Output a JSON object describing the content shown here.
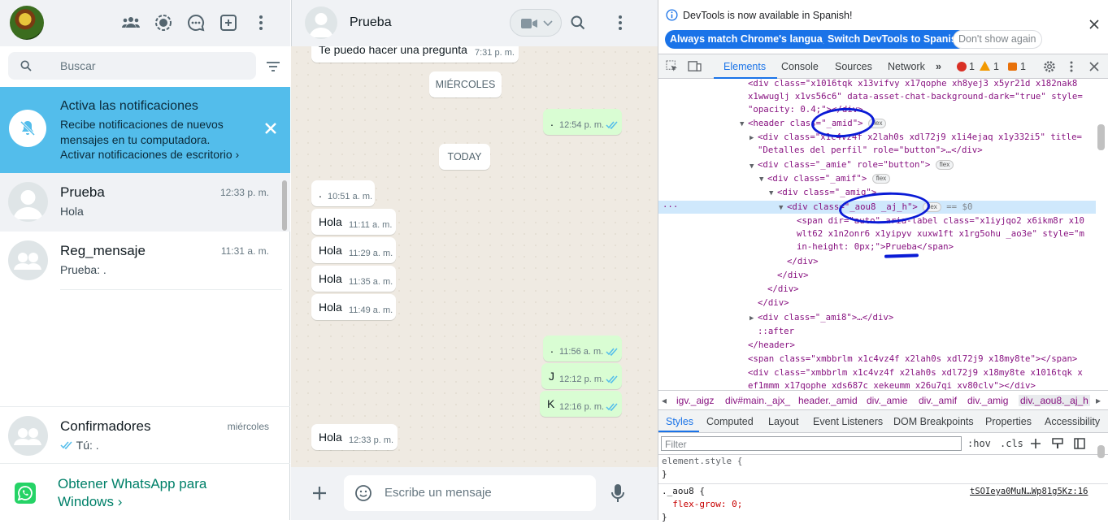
{
  "left": {
    "search_placeholder": "Buscar",
    "notification": {
      "title": "Activa las notificaciones",
      "body": "Recibe notificaciones de nuevos mensajes en tu computadora.",
      "link": "Activar notificaciones de escritorio"
    },
    "chats": [
      {
        "name": "Prueba",
        "time": "12:33 p. m.",
        "preview": "Hola"
      },
      {
        "name": "Reg_mensaje",
        "time": "11:31 a. m.",
        "preview": "Prueba: ."
      },
      {
        "name": "Confirmadores",
        "time": "miércoles",
        "preview": "Tú: ."
      }
    ],
    "get_app": "Obtener WhatsApp para Windows"
  },
  "center": {
    "contact_name": "Prueba",
    "input_placeholder": "Escribe un mensaje",
    "messages": [
      {
        "dir": "in",
        "text": "Te puedo hacer una pregunta",
        "time": "7:31 p. m."
      },
      {
        "dir": "date",
        "text": "MIÉRCOLES"
      },
      {
        "dir": "out",
        "text": ".",
        "time": "12:54 p. m."
      },
      {
        "dir": "date",
        "text": "TODAY"
      },
      {
        "dir": "in",
        "text": ".",
        "time": "10:51 a. m."
      },
      {
        "dir": "in",
        "text": "Hola",
        "time": "11:11 a. m."
      },
      {
        "dir": "in",
        "text": "Hola",
        "time": "11:29 a. m."
      },
      {
        "dir": "in",
        "text": "Hola",
        "time": "11:35 a. m."
      },
      {
        "dir": "in",
        "text": "Hola",
        "time": "11:49 a. m."
      },
      {
        "dir": "out",
        "text": ".",
        "time": "11:56 a. m."
      },
      {
        "dir": "out",
        "text": "J",
        "time": "12:12 p. m."
      },
      {
        "dir": "out",
        "text": "K",
        "time": "12:16 p. m."
      },
      {
        "dir": "in",
        "text": "Hola",
        "time": "12:33 p. m."
      }
    ]
  },
  "devtools": {
    "info_message": "DevTools is now available in Spanish!",
    "btn_match": "Always match Chrome's language",
    "btn_switch": "Switch DevTools to Spanish",
    "btn_dont_show": "Don't show again",
    "tabs": [
      "Elements",
      "Console",
      "Sources",
      "Network"
    ],
    "error_count": "1",
    "warning_count": "1",
    "issue_count": "1",
    "dom_lines": [
      "<div class=\"x1016tqk x13vifvy x17qophe xh8yej3 x5yr21d x182nak8",
      "x1wwuglj x1vs56c6\" data-asset-chat-background-dark=\"true\" style=",
      "\"opacity: 0.4;\"></div>",
      "<header class=\"_amid\">",
      "<div class=\"x1c4vz4f x2lah0s xdl72j9 x1i4ejaq x1y332i5\" title=",
      "\"Detalles del perfil\" role=\"button\">…</div>",
      "<div class=\"_amie\" role=\"button\">",
      "<div class=\"_amif\">",
      "<div class=\"_amig\">",
      "<div class=\"_aou8 _aj_h\">",
      "== $0",
      "<span dir=\"auto\" aria-label class=\"x1iyjqo2 x6ikm8r x10",
      "wlt62 x1n2onr6 x1yipyv xuxw1ft x1rg5ohu _ao3e\" style=\"m",
      "in-height: 0px;\">Prueba</span>",
      "</div>",
      "</div>",
      "</div>",
      "</div>",
      "<div class=\"_ami8\">…</div>",
      "::after",
      "</header>",
      "<span class=\"xmbbrlm x1c4vz4f x2lah0s xdl72j9 x18my8te\"></span>",
      "<div class=\"xmbbrlm x1c4vz4f x2lah0s xdl72j9 x18my8te x1016tqk x",
      "ef1mmm x17qophe xds687c xekeumm x26u7qi xv80clv\"></div>"
    ],
    "flex_badge": "flex",
    "breadcrumbs": [
      "igv._aigz",
      "div#main._ajx_",
      "header._amid",
      "div._amie",
      "div._amif",
      "div._amig",
      "div._aou8._aj_h"
    ],
    "subtabs": [
      "Styles",
      "Computed",
      "Layout",
      "Event Listeners",
      "DOM Breakpoints",
      "Properties",
      "Accessibility"
    ],
    "filter_placeholder": "Filter",
    "hov": ":hov",
    "cls": ".cls",
    "styles_lines": [
      "element.style {",
      "}",
      "._aou8 {",
      "  flex-grow: 0;",
      "}"
    ],
    "style_source": "tSOIeya0MuN…Wp81g5Kz:16"
  },
  "colors": {
    "accent": "#1a73e8",
    "wa_green": "#008069",
    "notif": "#53bdeb",
    "annotation": "#0a1bd6"
  }
}
